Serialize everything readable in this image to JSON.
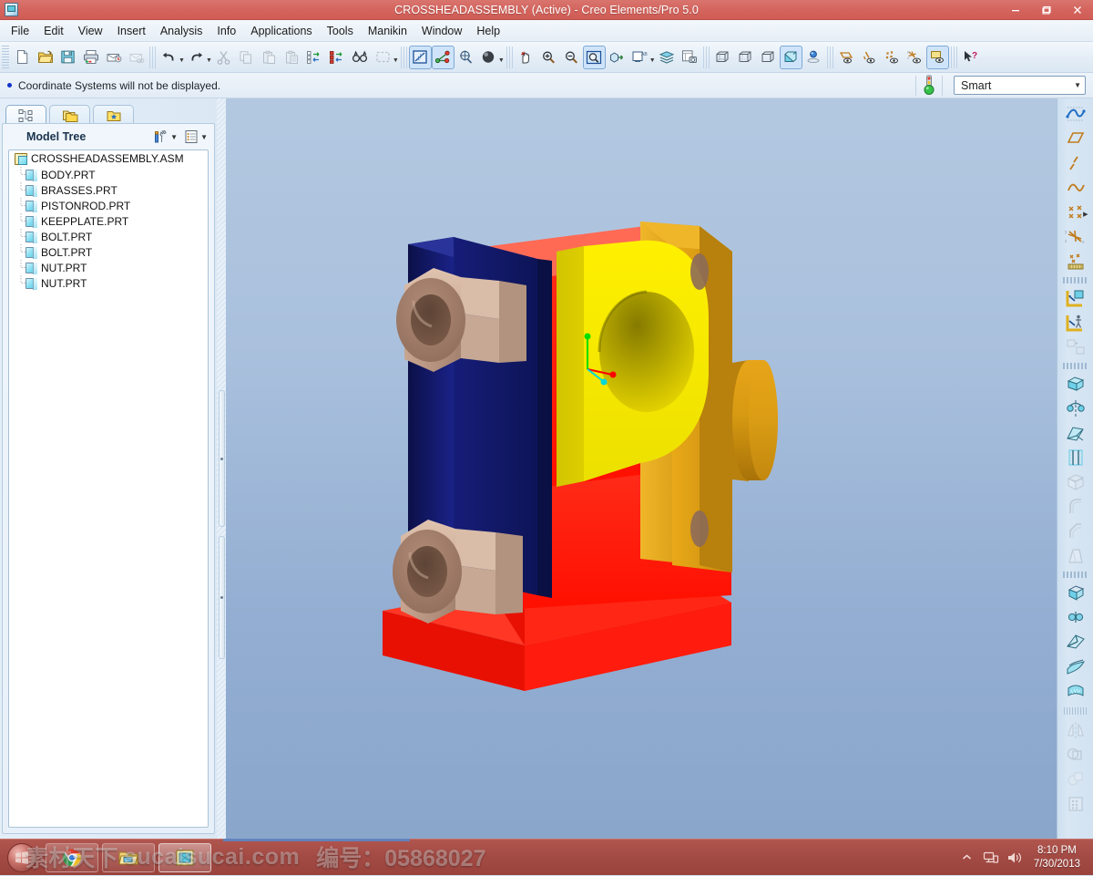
{
  "window": {
    "title": "CROSSHEADASSEMBLY (Active) - Creo Elements/Pro 5.0",
    "app_icon": "creo-window-icon",
    "controls": {
      "minimize": "minimize-icon",
      "maximize": "restore-icon",
      "close": "close-icon"
    }
  },
  "menubar": {
    "items": [
      {
        "label": "File"
      },
      {
        "label": "Edit"
      },
      {
        "label": "View"
      },
      {
        "label": "Insert"
      },
      {
        "label": "Analysis"
      },
      {
        "label": "Info"
      },
      {
        "label": "Applications"
      },
      {
        "label": "Tools"
      },
      {
        "label": "Manikin"
      },
      {
        "label": "Window"
      },
      {
        "label": "Help"
      }
    ]
  },
  "toolbar": {
    "groups": [
      {
        "name": "file-group",
        "buttons": [
          {
            "icon": "new-file-icon",
            "enabled": true
          },
          {
            "icon": "open-folder-icon",
            "enabled": true
          },
          {
            "icon": "save-icon",
            "enabled": true
          },
          {
            "icon": "print-icon",
            "enabled": true
          },
          {
            "icon": "send-mail-icon",
            "enabled": true
          },
          {
            "icon": "send-link-icon",
            "enabled": false
          }
        ]
      },
      {
        "name": "edit-group",
        "buttons": [
          {
            "icon": "undo-icon",
            "enabled": true,
            "dropdown": true
          },
          {
            "icon": "redo-icon",
            "enabled": true,
            "dropdown": true
          },
          {
            "icon": "cut-icon",
            "enabled": false
          },
          {
            "icon": "copy-icon",
            "enabled": false
          },
          {
            "icon": "paste-icon",
            "enabled": false
          },
          {
            "icon": "paste-special-icon",
            "enabled": false
          },
          {
            "icon": "regenerate-icon",
            "enabled": true
          },
          {
            "icon": "regenerate-manager-icon",
            "enabled": true
          },
          {
            "icon": "find-icon",
            "enabled": true
          },
          {
            "icon": "select-box-icon",
            "enabled": false,
            "dropdown": true
          }
        ]
      },
      {
        "name": "datum-display-group",
        "buttons": [
          {
            "icon": "datum-plane-display-icon",
            "enabled": true,
            "active": true
          },
          {
            "icon": "datum-axis-display-icon",
            "enabled": true,
            "active": true
          },
          {
            "icon": "datum-point-display-icon",
            "enabled": true
          },
          {
            "icon": "appearance-sphere-icon",
            "enabled": true,
            "dropdown": true
          }
        ]
      },
      {
        "name": "view-group",
        "buttons": [
          {
            "icon": "spin-hand-icon",
            "enabled": true
          },
          {
            "icon": "zoom-in-icon",
            "enabled": true
          },
          {
            "icon": "zoom-out-icon",
            "enabled": true
          },
          {
            "icon": "refit-icon",
            "enabled": true,
            "active": true
          },
          {
            "icon": "reorient-icon",
            "enabled": true
          },
          {
            "icon": "saved-view-icon",
            "enabled": true,
            "dropdown": true
          },
          {
            "icon": "layers-icon",
            "enabled": true
          },
          {
            "icon": "view-manager-icon",
            "enabled": true
          }
        ]
      },
      {
        "name": "display-style-group",
        "buttons": [
          {
            "icon": "wireframe-icon",
            "enabled": true
          },
          {
            "icon": "hidden-line-icon",
            "enabled": true
          },
          {
            "icon": "no-hidden-icon",
            "enabled": true
          },
          {
            "icon": "shading-icon",
            "enabled": true,
            "active": true
          },
          {
            "icon": "light-source-icon",
            "enabled": true
          }
        ]
      },
      {
        "name": "datum-toggle-group",
        "buttons": [
          {
            "icon": "plane-visibility-icon",
            "enabled": true
          },
          {
            "icon": "axis-visibility-icon",
            "enabled": true
          },
          {
            "icon": "point-visibility-icon",
            "enabled": true
          },
          {
            "icon": "csys-visibility-icon",
            "enabled": true
          },
          {
            "icon": "annotation-visibility-icon",
            "enabled": true,
            "active": true
          }
        ]
      },
      {
        "name": "help-group",
        "buttons": [
          {
            "icon": "context-help-icon",
            "enabled": true
          }
        ]
      }
    ]
  },
  "message_bar": {
    "bullet": "message-bullet",
    "text": "Coordinate Systems will not be displayed.",
    "status_icon": "traffic-light-icon",
    "filter_combo": {
      "value": "Smart",
      "caret": "chevron-down-icon"
    }
  },
  "navigator": {
    "tabs": [
      {
        "name": "model-tree-tab",
        "icon": "model-tree-icon",
        "selected": true
      },
      {
        "name": "folder-browser-tab",
        "icon": "folders-icon",
        "selected": false
      },
      {
        "name": "favorites-tab",
        "icon": "favorites-folder-icon",
        "selected": false
      }
    ],
    "panel_title": "Model Tree",
    "header_buttons": [
      {
        "name": "settings-button",
        "icon": "tools-settings-icon",
        "caret": "chevron-down-icon"
      },
      {
        "name": "show-button",
        "icon": "list-show-icon",
        "caret": "chevron-down-icon"
      }
    ],
    "tree": {
      "root": {
        "label": "CROSSHEADASSEMBLY.ASM",
        "icon": "assembly-icon"
      },
      "children": [
        {
          "label": "BODY.PRT",
          "icon": "part-icon"
        },
        {
          "label": "BRASSES.PRT",
          "icon": "part-icon"
        },
        {
          "label": "PISTONROD.PRT",
          "icon": "part-icon"
        },
        {
          "label": "KEEPPLATE.PRT",
          "icon": "part-icon"
        },
        {
          "label": "BOLT.PRT",
          "icon": "part-icon"
        },
        {
          "label": "BOLT.PRT",
          "icon": "part-icon"
        },
        {
          "label": "NUT.PRT",
          "icon": "part-icon"
        },
        {
          "label": "NUT.PRT",
          "icon": "part-icon"
        }
      ]
    }
  },
  "right_toolbar": {
    "sections": [
      {
        "name": "datum-create-section",
        "buttons": [
          {
            "icon": "sketch-curve-icon",
            "enabled": true
          },
          {
            "icon": "datum-plane-icon",
            "enabled": true
          },
          {
            "icon": "datum-axis-icon",
            "enabled": true
          },
          {
            "icon": "datum-curve-icon",
            "enabled": true
          },
          {
            "icon": "datum-point-icon",
            "enabled": true,
            "flyout": true
          },
          {
            "icon": "coordinate-system-icon",
            "enabled": true
          },
          {
            "icon": "analysis-feature-icon",
            "enabled": true
          }
        ]
      },
      {
        "name": "component-section",
        "buttons": [
          {
            "icon": "create-component-icon",
            "enabled": true
          },
          {
            "icon": "assemble-component-icon",
            "enabled": true
          },
          {
            "icon": "pattern-component-icon",
            "enabled": false
          }
        ]
      },
      {
        "name": "feature-section",
        "buttons": [
          {
            "icon": "extrude-icon",
            "enabled": true
          },
          {
            "icon": "revolve-icon",
            "enabled": true
          },
          {
            "icon": "sweep-blend-icon",
            "enabled": true
          },
          {
            "icon": "hole-icon",
            "enabled": true
          },
          {
            "icon": "shell-icon",
            "enabled": false
          },
          {
            "icon": "round-icon",
            "enabled": false
          },
          {
            "icon": "chamfer-icon",
            "enabled": false
          },
          {
            "icon": "draft-icon",
            "enabled": false
          }
        ]
      },
      {
        "name": "surface-section",
        "buttons": [
          {
            "icon": "solidify-icon",
            "enabled": true
          },
          {
            "icon": "merge-surfaces-icon",
            "enabled": true
          },
          {
            "icon": "trim-surface-icon",
            "enabled": true
          },
          {
            "icon": "offset-surface-icon",
            "enabled": true
          },
          {
            "icon": "fill-surface-icon",
            "enabled": true
          }
        ]
      },
      {
        "name": "transform-section",
        "buttons": [
          {
            "icon": "mirror-icon",
            "enabled": false
          },
          {
            "icon": "merge-icon",
            "enabled": false
          },
          {
            "icon": "intersect-icon",
            "enabled": false
          },
          {
            "icon": "pattern-icon",
            "enabled": false
          }
        ]
      }
    ]
  },
  "model": {
    "name": "crosshead-assembly-3d-view",
    "csys_label": "",
    "colors": {
      "background_top": "#b3c8e0",
      "background_bottom": "#8aa6cb",
      "body_red": "#ff1b0d",
      "body_red_dark": "#e01005",
      "brasses_navy": "#131a72",
      "brasses_navy_dark": "#0c1152",
      "keepplate_yellow": "#f2e400",
      "keepplate_yellow_dark": "#d6c800",
      "pistonrod_gold": "#d79a12",
      "pistonrod_gold_dark": "#b88010",
      "nut_tan": "#c9a792",
      "nut_tan_dark": "#9d7563",
      "csys_x": "#ff0000",
      "csys_y": "#00e000",
      "csys_z": "#00d8d8"
    }
  },
  "taskbar": {
    "start_button": "windows-start-orb",
    "tasks": [
      {
        "name": "chrome-task",
        "icon": "chrome-icon",
        "active": false
      },
      {
        "name": "explorer-task",
        "icon": "folder-window-icon",
        "active": false
      },
      {
        "name": "creo-task",
        "icon": "creo-icon",
        "active": true
      }
    ],
    "tray": [
      {
        "name": "show-hidden-icons",
        "icon": "chevron-up-icon"
      },
      {
        "name": "network-icon",
        "icon": "network-icon"
      },
      {
        "name": "volume-icon",
        "icon": "speaker-icon"
      }
    ],
    "clock": {
      "time": "8:10 PM",
      "date": "7/30/2013"
    }
  },
  "watermark": {
    "site_cn": "素材天下",
    "site_en": "sucaisucai.com",
    "id_label": "编号：",
    "id_value": "05868027"
  }
}
